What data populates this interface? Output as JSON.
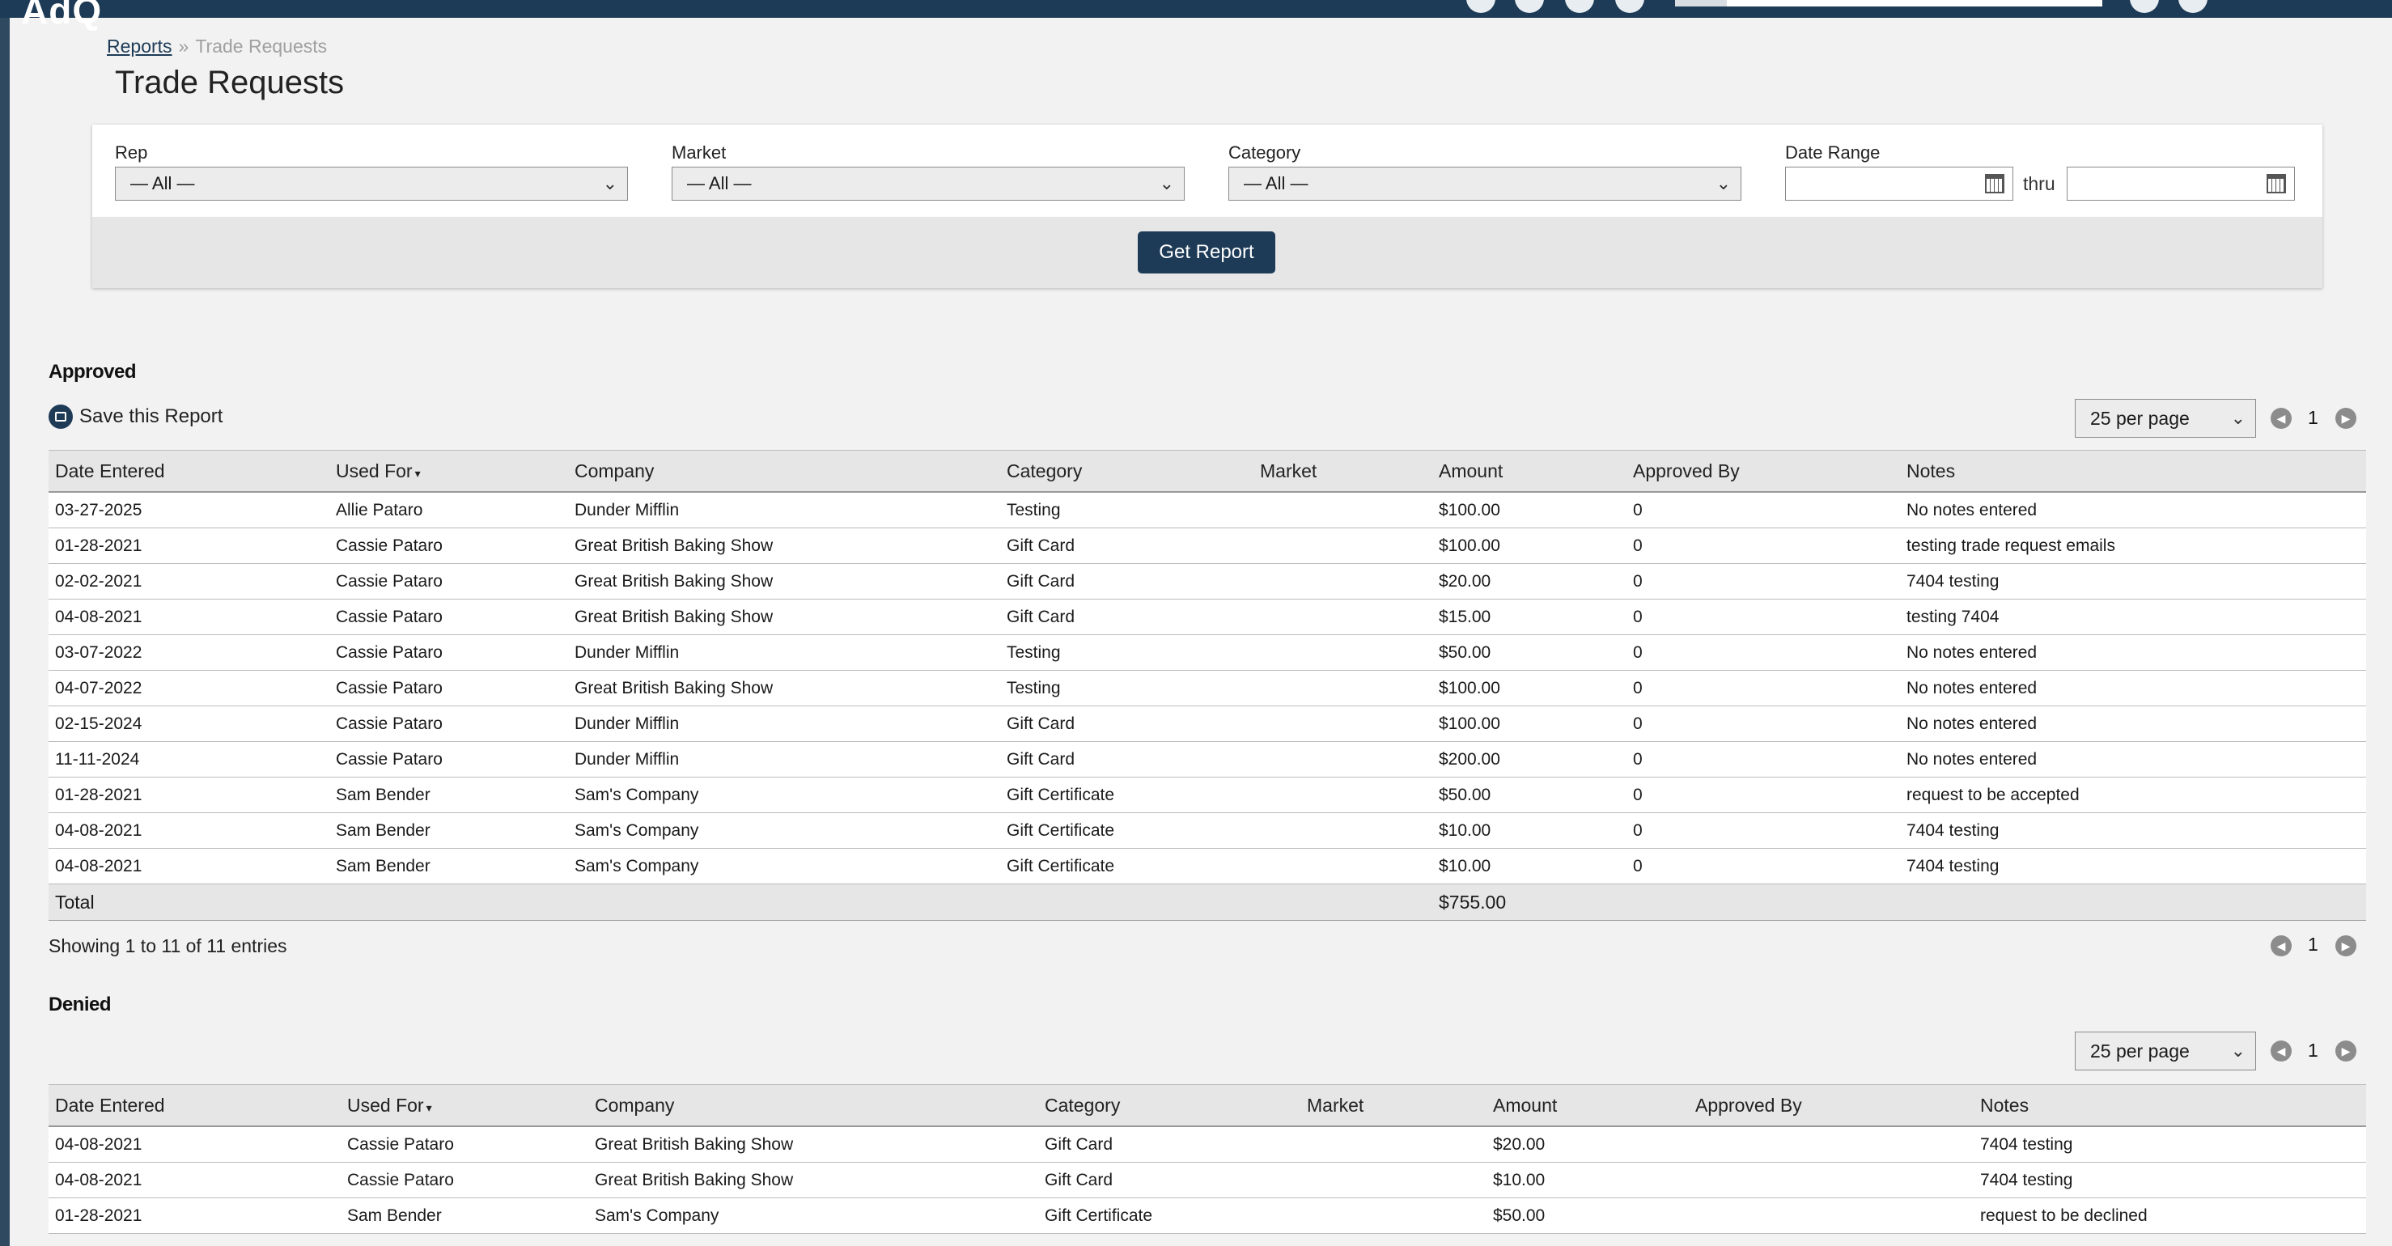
{
  "app": {
    "logo_text": "AdQ"
  },
  "breadcrumb": {
    "parent": "Reports",
    "separator": "»",
    "current": "Trade Requests"
  },
  "page": {
    "title": "Trade Requests"
  },
  "filters": {
    "rep": {
      "label": "Rep",
      "value": "— All —"
    },
    "market": {
      "label": "Market",
      "value": "— All —"
    },
    "category": {
      "label": "Category",
      "value": "— All —"
    },
    "date_range": {
      "label": "Date Range",
      "thru": "thru",
      "start": "",
      "end": ""
    },
    "submit_label": "Get Report"
  },
  "approved": {
    "title": "Approved",
    "save_label": "Save this Report",
    "per_page": "25 per page",
    "page": "1",
    "columns": [
      "Date Entered",
      "Used For",
      "Company",
      "Category",
      "Market",
      "Amount",
      "Approved By",
      "Notes"
    ],
    "rows": [
      [
        "03-27-2025",
        "Allie Pataro",
        "Dunder Mifflin",
        "Testing",
        "",
        "$100.00",
        "0",
        "No notes entered"
      ],
      [
        "01-28-2021",
        "Cassie Pataro",
        "Great British Baking Show",
        "Gift Card",
        "",
        "$100.00",
        "0",
        "testing trade request emails"
      ],
      [
        "02-02-2021",
        "Cassie Pataro",
        "Great British Baking Show",
        "Gift Card",
        "",
        "$20.00",
        "0",
        "7404 testing"
      ],
      [
        "04-08-2021",
        "Cassie Pataro",
        "Great British Baking Show",
        "Gift Card",
        "",
        "$15.00",
        "0",
        "testing 7404"
      ],
      [
        "03-07-2022",
        "Cassie Pataro",
        "Dunder Mifflin",
        "Testing",
        "",
        "$50.00",
        "0",
        "No notes entered"
      ],
      [
        "04-07-2022",
        "Cassie Pataro",
        "Great British Baking Show",
        "Testing",
        "",
        "$100.00",
        "0",
        "No notes entered"
      ],
      [
        "02-15-2024",
        "Cassie Pataro",
        "Dunder Mifflin",
        "Gift Card",
        "",
        "$100.00",
        "0",
        "No notes entered"
      ],
      [
        "11-11-2024",
        "Cassie Pataro",
        "Dunder Mifflin",
        "Gift Card",
        "",
        "$200.00",
        "0",
        "No notes entered"
      ],
      [
        "01-28-2021",
        "Sam Bender",
        "Sam's Company",
        "Gift Certificate",
        "",
        "$50.00",
        "0",
        "request to be accepted"
      ],
      [
        "04-08-2021",
        "Sam Bender",
        "Sam's Company",
        "Gift Certificate",
        "",
        "$10.00",
        "0",
        "7404 testing"
      ],
      [
        "04-08-2021",
        "Sam Bender",
        "Sam's Company",
        "Gift Certificate",
        "",
        "$10.00",
        "0",
        "7404 testing"
      ]
    ],
    "total_label": "Total",
    "total_amount": "$755.00",
    "showing": "Showing 1 to 11 of 11 entries",
    "bottom_page": "1"
  },
  "denied": {
    "title": "Denied",
    "per_page": "25 per page",
    "page": "1",
    "columns": [
      "Date Entered",
      "Used For",
      "Company",
      "Category",
      "Market",
      "Amount",
      "Approved By",
      "Notes"
    ],
    "rows": [
      [
        "04-08-2021",
        "Cassie Pataro",
        "Great British Baking Show",
        "Gift Card",
        "",
        "$20.00",
        "",
        "7404 testing"
      ],
      [
        "04-08-2021",
        "Cassie Pataro",
        "Great British Baking Show",
        "Gift Card",
        "",
        "$10.00",
        "",
        "7404 testing"
      ],
      [
        "01-28-2021",
        "Sam Bender",
        "Sam's Company",
        "Gift Certificate",
        "",
        "$50.00",
        "",
        "request to be declined"
      ]
    ]
  },
  "icons": {
    "select_chevron": "chevron-down-icon",
    "calendar": "calendar-icon",
    "save": "save-icon",
    "pager_prev": "chevron-left-icon",
    "pager_next": "chevron-right-icon",
    "sort": "sort-caret-icon"
  },
  "colors": {
    "brand": "#1d3b57",
    "header_bg": "#e6e6e6",
    "page_bg": "#f2f2f2"
  }
}
